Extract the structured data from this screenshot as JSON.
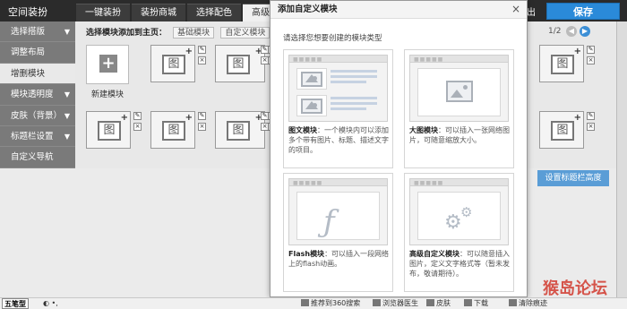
{
  "app": {
    "title": "空间装扮"
  },
  "tabs": [
    {
      "label": "一键装扮"
    },
    {
      "label": "装扮商城"
    },
    {
      "label": "选择配色"
    },
    {
      "label": "高级"
    }
  ],
  "top_right": {
    "partial": "出",
    "save": "保存"
  },
  "sidebar": {
    "items": [
      {
        "label": "选择搭版",
        "arrow": "▼"
      },
      {
        "label": "调整布局",
        "arrow": ""
      },
      {
        "label": "增删模块",
        "arrow": ""
      },
      {
        "label": "模块透明度",
        "arrow": "▼"
      },
      {
        "label": "皮肤（背景）",
        "arrow": "▼"
      },
      {
        "label": "标题栏设置",
        "arrow": "▼"
      },
      {
        "label": "自定义导航",
        "arrow": ""
      }
    ]
  },
  "main": {
    "crumb_label": "选择模块添加到主页：",
    "crumb_chips": [
      "基础模块",
      "自定义模块"
    ],
    "new_module": "新建模块",
    "pager": "1/2",
    "title_height_button": "设置标题栏高度"
  },
  "dialog": {
    "title": "添加自定义模块",
    "close": "×",
    "intro": "请选择您想要创建的模块类型",
    "cards": [
      {
        "name": "图文模块",
        "desc": "：一个模块内可以添加多个带有图片、标题、描述文字的项目。"
      },
      {
        "name": "大图模块",
        "desc": "：可以插入一张网络图片，可随意缩放大小。"
      },
      {
        "name": "Flash模块",
        "desc": "：可以插入一段网络上的flash动画。"
      },
      {
        "name": "高级自定义模块",
        "desc": "：可以随意插入图片，定义文字格式等（暂未发布，敬请期待）。"
      }
    ]
  },
  "statusbar": {
    "ime": "五笔型",
    "items": [
      "推荐到360搜索",
      "浏览器医生",
      "皮肤",
      "下载",
      "清除痕迹"
    ]
  },
  "colors": {
    "save_blue": "#2a8ad9",
    "topbar": "#2b2b2b",
    "sidebar": "#7a7a7a"
  }
}
